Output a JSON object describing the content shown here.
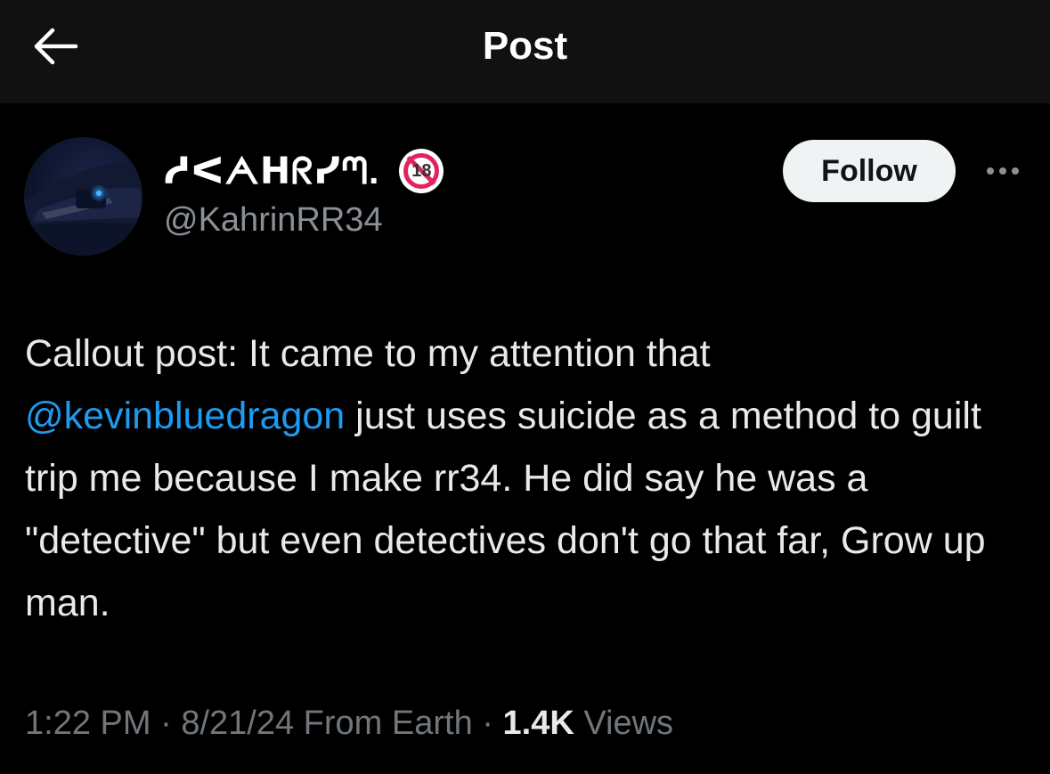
{
  "header": {
    "title": "Post",
    "back_icon": "arrow-left-icon"
  },
  "author": {
    "display_name": "ᓱᐸᗅᕼᖇᓯᘉ.",
    "badge_text": "18",
    "badge_icon": "no-under-18-icon",
    "handle": "@KahrinRR34"
  },
  "actions": {
    "follow_label": "Follow",
    "more_icon": "more-horizontal-icon"
  },
  "post": {
    "text_before_mention": "Callout post: It came to my attention that ",
    "mention": "@kevinbluedragon",
    "text_after_mention": " just uses suicide as a method to guilt trip me because I make rr34. He did say he was a \"detective\" but even detectives don't go that far, Grow up man."
  },
  "meta": {
    "time": "1:22 PM",
    "separator": " · ",
    "date": "8/21/24",
    "source": " From Earth",
    "views_count": "1.4K",
    "views_label": " Views"
  },
  "colors": {
    "background": "#000000",
    "header_bg": "#111111",
    "text": "#e7e9ea",
    "muted": "#71767b",
    "link": "#1d9bf0",
    "follow_bg": "#eff3f4"
  }
}
